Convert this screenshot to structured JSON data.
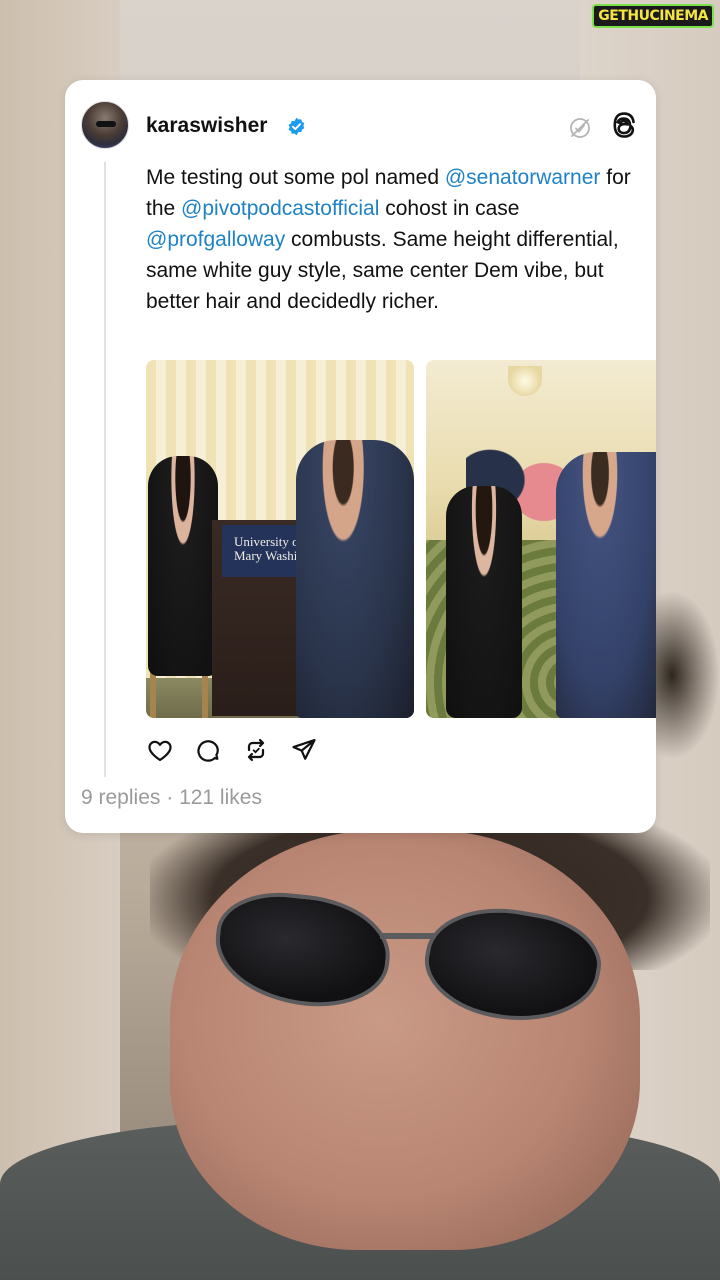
{
  "watermark": "GETHUCINEMA",
  "post": {
    "username": "karaswisher",
    "verified": true,
    "text_parts": {
      "p1": "Me testing out some pol named ",
      "m1": "@senatorwarner",
      "p2": " for the ",
      "m2": "@pivotpodcastofficial",
      "p3": " cohost in case ",
      "m3": "@profgalloway",
      "p4": " combusts. Same height differential, same white guy style, same center Dem vibe, but better hair and decidedly richer."
    },
    "photo1_sign": "University of Mary Washin",
    "stats": {
      "replies": "9 replies",
      "separator": " · ",
      "likes": "121 likes"
    }
  },
  "icons": {
    "verified": "verified-badge-icon",
    "muted": "muted-icon",
    "threads": "threads-logo-icon",
    "like": "heart-icon",
    "reply": "comment-icon",
    "repost": "repost-icon",
    "share": "share-icon"
  },
  "colors": {
    "mention": "#1f82c4",
    "verified": "#1d9bf0",
    "stats": "#9a9a9a",
    "card": "#ffffff"
  }
}
